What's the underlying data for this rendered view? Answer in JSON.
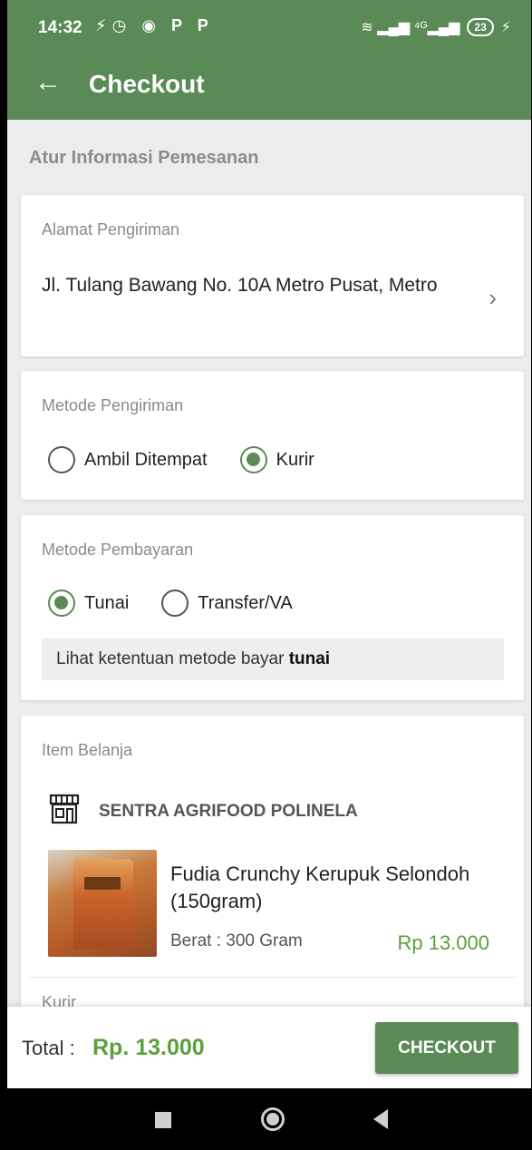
{
  "status_bar": {
    "time": "14:32",
    "left_icons": [
      "no-notification-icon",
      "alarm-icon",
      "app-icon",
      "parking-icon",
      "parking-icon"
    ],
    "left_glyphs": "⚡◷ ◉ P P",
    "right_icons": [
      "wifi-icon",
      "signal-icon",
      "4g-signal-icon",
      "battery-icon",
      "charging-icon"
    ],
    "right_glyphs": "≋ ▂▄▆ ⁴ᴳ▂▄▆",
    "battery": "23",
    "charging_glyph": "⚡"
  },
  "appbar": {
    "back_icon": "←",
    "title": "Checkout",
    "color": "#5a8a55"
  },
  "section_title": "Atur Informasi Pemesanan",
  "address": {
    "label": "Alamat Pengiriman",
    "value": "Jl. Tulang Bawang No. 10A Metro Pusat, Metro",
    "chevron": "›"
  },
  "shipping": {
    "label": "Metode Pengiriman",
    "options": [
      {
        "label": "Ambil Ditempat",
        "checked": false
      },
      {
        "label": "Kurir",
        "checked": true
      }
    ]
  },
  "payment": {
    "label": "Metode Pembayaran",
    "options": [
      {
        "label": "Tunai",
        "checked": true
      },
      {
        "label": "Transfer/VA",
        "checked": false
      }
    ],
    "note_prefix": "Lihat ketentuan metode bayar ",
    "note_bold": "tunai"
  },
  "items": {
    "label": "Item Belanja",
    "store_name": "SENTRA AGRIFOOD POLINELA",
    "product": {
      "name": "Fudia Crunchy Kerupuk Selondoh (150gram)",
      "weight": "Berat : 300 Gram",
      "price": "Rp 13.000"
    },
    "courier_label": "Kurir"
  },
  "footer": {
    "total_label": "Total :",
    "total_value": "Rp. 13.000",
    "checkout_label": "CHECKOUT",
    "accent": "#5aa13a"
  }
}
